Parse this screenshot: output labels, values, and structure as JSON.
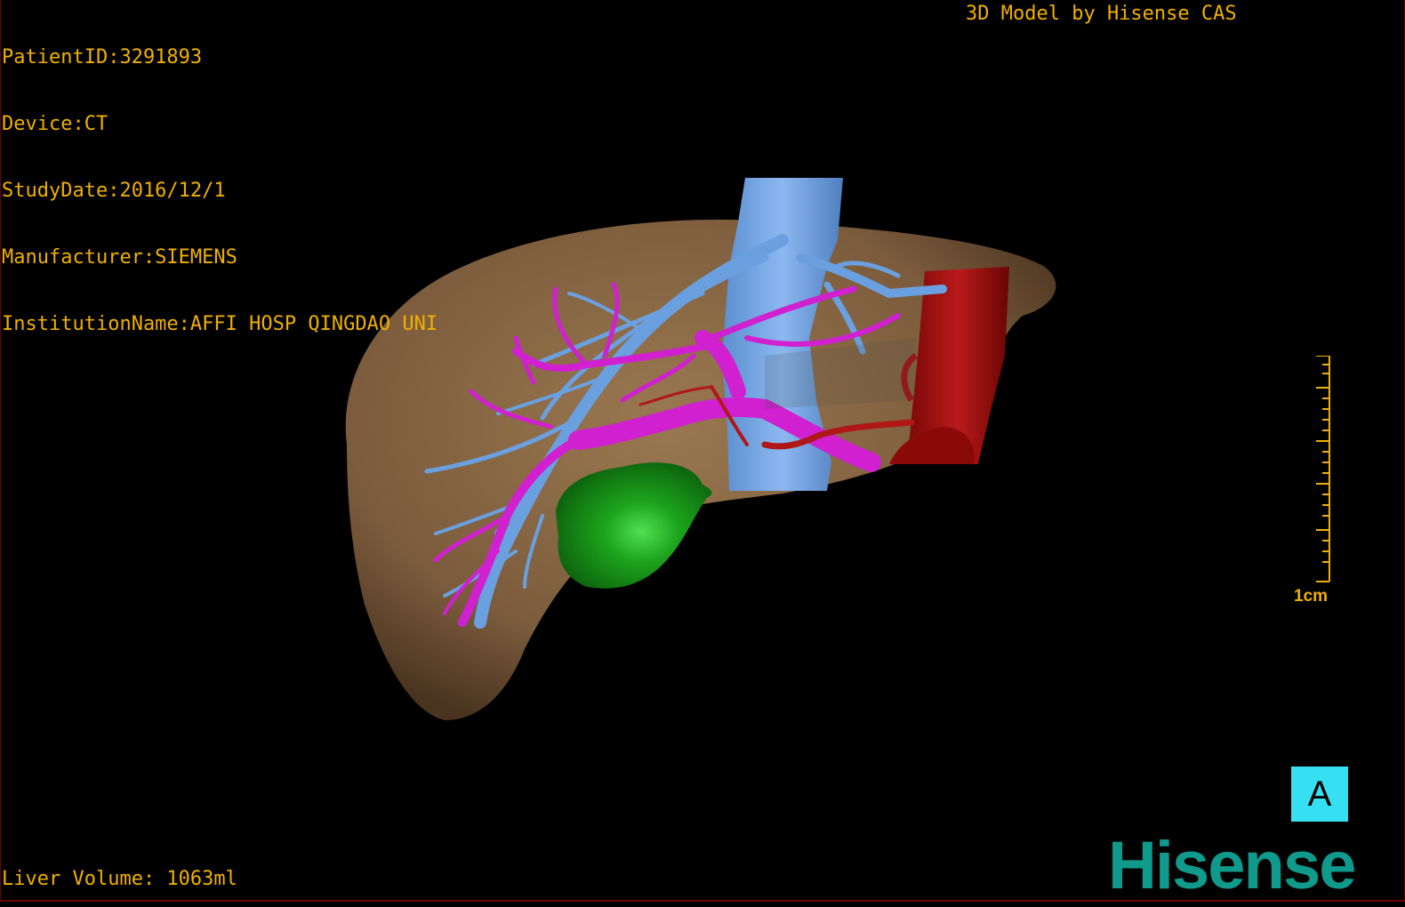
{
  "header": {
    "patient_id": "PatientID:3291893",
    "device": "Device:CT",
    "study_date": "StudyDate:2016/12/1",
    "manufacturer": "Manufacturer:SIEMENS",
    "institution": "InstitutionName:AFFI HOSP QINGDAO UNI",
    "credit": "3D Model by Hisense CAS"
  },
  "footer": {
    "liver_volume": "Liver Volume: 1063ml"
  },
  "scale": {
    "label": "1cm"
  },
  "orientation": {
    "label": "A"
  },
  "brand": {
    "logo_text": "Hisense"
  },
  "colors": {
    "overlay_text": "#f0b000",
    "liver": "#8b6a47",
    "portal_vein": "#d020d0",
    "hepatic_vein_ivc": "#6aa0e0",
    "aorta": "#a81010",
    "tumor": "#1aa01a",
    "orientation_box": "#36e0f2",
    "logo": "#0f9a8c"
  }
}
